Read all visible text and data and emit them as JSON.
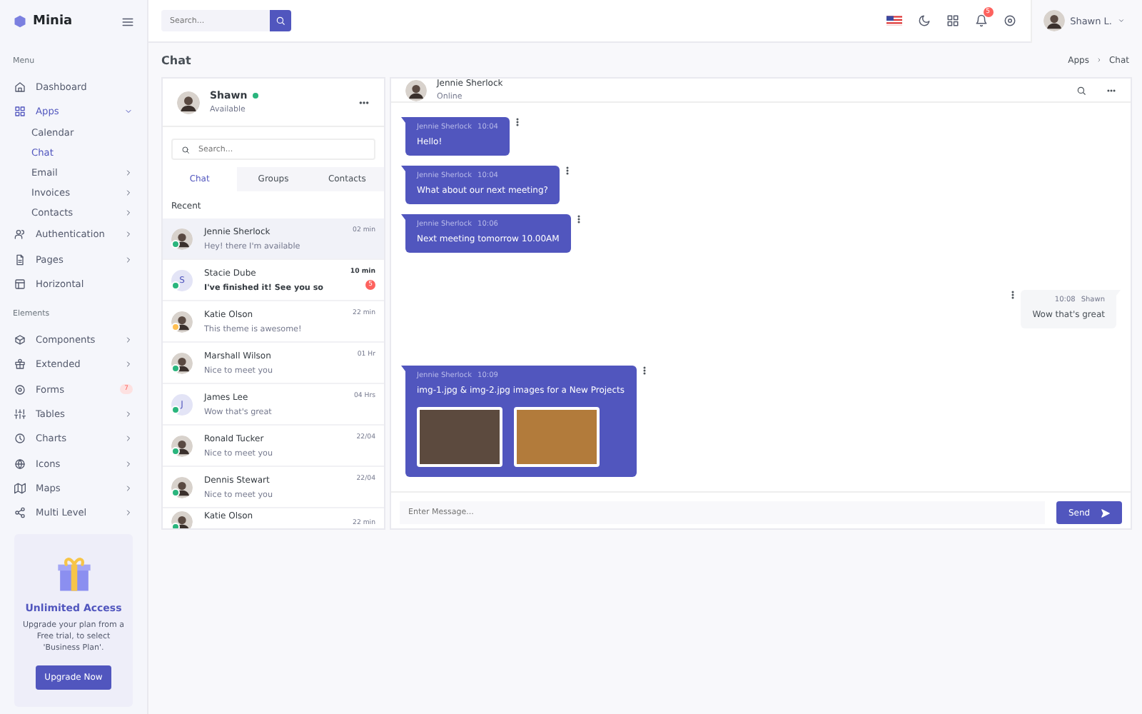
{
  "sidebar": {
    "brand": "Minia",
    "sections": [
      {
        "title": "Menu",
        "items": [
          {
            "label": "Dashboard",
            "kind": "link",
            "selected": false
          },
          {
            "label": "Apps",
            "kind": "submenu",
            "expanded": true,
            "selected": true,
            "children": [
              {
                "label": "Calendar",
                "kind": "link",
                "selected": false
              },
              {
                "label": "Chat",
                "kind": "link",
                "selected": true
              },
              {
                "label": "Email",
                "kind": "submenu",
                "expanded": false,
                "selected": false
              },
              {
                "label": "Invoices",
                "kind": "submenu",
                "expanded": false,
                "selected": false
              },
              {
                "label": "Contacts",
                "kind": "submenu",
                "expanded": false,
                "selected": false
              }
            ]
          },
          {
            "label": "Authentication",
            "kind": "submenu",
            "expanded": false,
            "selected": false
          },
          {
            "label": "Pages",
            "kind": "submenu",
            "expanded": false,
            "selected": false
          },
          {
            "label": "Horizontal",
            "kind": "link",
            "selected": false
          }
        ]
      },
      {
        "title": "Elements",
        "items": [
          {
            "label": "Components",
            "kind": "submenu",
            "expanded": false,
            "selected": false
          },
          {
            "label": "Extended",
            "kind": "submenu",
            "expanded": false,
            "selected": false
          },
          {
            "label": "Forms",
            "kind": "badge",
            "badge": "7",
            "selected": false
          },
          {
            "label": "Tables",
            "kind": "submenu",
            "expanded": false,
            "selected": false
          },
          {
            "label": "Charts",
            "kind": "submenu",
            "expanded": false,
            "selected": false
          },
          {
            "label": "Icons",
            "kind": "submenu",
            "expanded": false,
            "selected": false
          },
          {
            "label": "Maps",
            "kind": "submenu",
            "expanded": false,
            "selected": false
          },
          {
            "label": "Multi Level",
            "kind": "submenu",
            "expanded": false,
            "selected": false
          }
        ]
      }
    ],
    "upgrade": {
      "title": "Unlimited Access",
      "text": "Upgrade your plan from a Free trial, to select 'Business Plan'.",
      "button": "Upgrade Now"
    }
  },
  "topbar": {
    "search": {
      "placeholder": "Search..."
    },
    "notifications": "5",
    "user": "Shawn L."
  },
  "page": {
    "title": "Chat",
    "breadcrumb": [
      "Apps",
      "Chat"
    ]
  },
  "chat_list": {
    "user": {
      "name": "Shawn",
      "status": "Available",
      "online": true
    },
    "search": {
      "placeholder": "Search..."
    },
    "tabs": [
      {
        "label": "Chat",
        "selected": true
      },
      {
        "label": "Groups",
        "selected": false
      },
      {
        "label": "Contacts",
        "selected": false
      }
    ],
    "section": "Recent",
    "contacts": [
      {
        "name": "Jennie Sherlock",
        "message": "Hey! there I'm available",
        "time": "02 min",
        "kind": "photo",
        "color": "#2ab57d",
        "unread": false,
        "selected": true
      },
      {
        "name": "Stacie Dube",
        "message": "I've finished it! See you so",
        "time": "10 min",
        "kind": "initial",
        "initial": "S",
        "color": "#2ab57d",
        "unread": true,
        "badge": "5",
        "selected": false
      },
      {
        "name": "Katie Olson",
        "message": "This theme is awesome!",
        "time": "22 min",
        "kind": "photo",
        "color": "#ffbf53",
        "unread": false,
        "selected": false
      },
      {
        "name": "Marshall Wilson",
        "message": "Nice to meet you",
        "time": "01 Hr",
        "kind": "photo",
        "color": "#2ab57d",
        "unread": false,
        "selected": false
      },
      {
        "name": "James Lee",
        "message": "Wow that's great",
        "time": "04 Hrs",
        "kind": "initial",
        "initial": "J",
        "color": "#2ab57d",
        "unread": false,
        "selected": false
      },
      {
        "name": "Ronald Tucker",
        "message": "Nice to meet you",
        "time": "22/04",
        "kind": "photo",
        "color": "#2ab57d",
        "unread": false,
        "selected": false
      },
      {
        "name": "Dennis Stewart",
        "message": "Nice to meet you",
        "time": "22/04",
        "kind": "photo",
        "color": "#2ab57d",
        "unread": false,
        "selected": false
      },
      {
        "name": "Katie Olson",
        "time": "22 min",
        "kind": "photo",
        "color": "#2ab57d",
        "unread": false,
        "selected": false
      }
    ]
  },
  "conversation": {
    "name": "Jennie Sherlock",
    "status": "Online",
    "messages": [
      {
        "kind": "incoming",
        "name": "Jennie Sherlock",
        "time": "10:04",
        "text": "Hello!"
      },
      {
        "kind": "incoming",
        "name": "Jennie Sherlock",
        "time": "10:04",
        "text": "What about our next meeting?"
      },
      {
        "kind": "incoming",
        "name": "Jennie Sherlock",
        "time": "10:06",
        "text": "Next meeting tomorrow 10.00AM"
      },
      {
        "kind": "outgoing",
        "name": "Shawn",
        "time": "10:08",
        "text": "Wow that's great"
      },
      {
        "kind": "incoming",
        "name": "Jennie Sherlock",
        "time": "10:09",
        "text": "img-1.jpg & img-2.jpg images for a New Projects",
        "attachments": [
          {
            "kind": "photo"
          },
          {
            "kind": "photo"
          }
        ]
      }
    ],
    "composer": {
      "placeholder": "Enter Message...",
      "button": "Send"
    }
  }
}
